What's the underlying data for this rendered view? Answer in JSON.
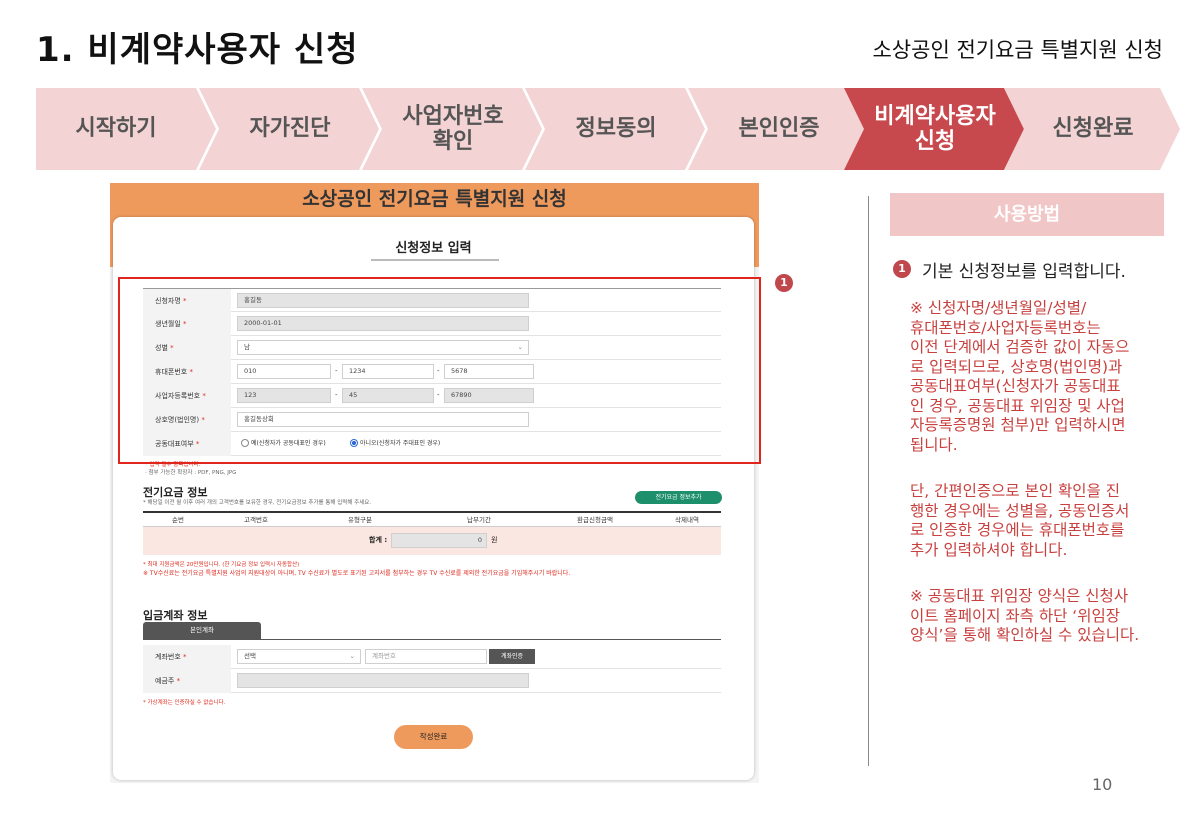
{
  "header": {
    "title": "1. 비계약사용자 신청",
    "subtitle": "소상공인 전기요금 특별지원 신청"
  },
  "steps": [
    {
      "label": "시작하기",
      "active": false
    },
    {
      "label": "자가진단",
      "active": false
    },
    {
      "label": "사업자번호\n확인",
      "active": false
    },
    {
      "label": "정보동의",
      "active": false
    },
    {
      "label": "본인인증",
      "active": false
    },
    {
      "label": "비계약사용자\n신청",
      "active": true
    },
    {
      "label": "신청완료",
      "active": false
    }
  ],
  "colors": {
    "step_inactive": "#f3d3d4",
    "step_active": "#c8494d",
    "accent_orange": "#ef9a5d",
    "highlight_red": "#e0261c",
    "note_red": "#c8413f"
  },
  "form": {
    "page_title": "소상공인 전기요금 특별지원 신청",
    "card_title": "신청정보 입력",
    "fields": {
      "applicant_name": {
        "label": "신청자명",
        "value": "홍길동"
      },
      "birth_date": {
        "label": "생년월일",
        "value": "2000-01-01"
      },
      "gender": {
        "label": "성별",
        "value": "남"
      },
      "mobile": {
        "label": "휴대폰번호",
        "part1": "010",
        "part2": "1234",
        "part3": "5678"
      },
      "biz_no": {
        "label": "사업자등록번호",
        "part1": "123",
        "part2": "45",
        "part3": "67890"
      },
      "company_name": {
        "label": "상호명(법인명)",
        "value": "홍길동상회"
      },
      "co_rep": {
        "label": "공동대표여부",
        "opt_yes": "예(신청자가 공동대표인 경우)",
        "opt_no": "아니오(신청자가 주대표인 경우)"
      }
    },
    "note_required": "* 입력 필수 항목입니다.",
    "note_attach": "· 첨부 가능한 확장자 : PDF, PNG, JPG",
    "electric": {
      "title": "전기요금 정보",
      "desc": "* 해당일 이전 월 이후 여러 개의 고객번호를 보유한 경우, 전기요금정보 추가를 통해 입력해 주세요.",
      "add_button": "전기요금 정보추가",
      "columns": [
        "순번",
        "고객번호",
        "유형구분",
        "납부기간",
        "환급신청금액",
        "삭제내역"
      ],
      "sum_label": "합계 :",
      "sum_value": "0",
      "sum_unit": "원",
      "note1": "* 최대 지원금액은 20만원입니다. (한 기요금 정보 입력시 자동합산)",
      "note2": "※ TV수신료는 전기요금 특별지원 사업의 지원대상이 아니며, TV 수신료가 별도로 표기된 고지서를 첨부하는 경우 TV 수신료를 제외한 전기요금을 기입해주시기 바랍니다."
    },
    "deposit": {
      "title": "입금계좌 정보",
      "tab": "본인계좌",
      "account_label": "계좌번호",
      "bank_select": "선택",
      "account_placeholder": "계좌번호",
      "verify_button": "계좌인증",
      "holder_label": "예금주",
      "note": "* 가상계좌는 인증하실 수 없습니다."
    },
    "submit_button": "작성완료"
  },
  "callout_number": "1",
  "usage": {
    "title": "사용방법",
    "step_number": "1",
    "main": "기본 신청정보를 입력합니다.",
    "note1": "※ 신청자명/생년월일/성별/\n휴대폰번호/사업자등록번호는\n이전 단계에서 검증한 값이 자동으\n로 입력되므로, 상호명(법인명)과\n공동대표여부(신청자가 공동대표\n인 경우, 공동대표 위임장 및 사업\n자등록증명원 첨부)만 입력하시면\n됩니다.",
    "note2": "단, 간편인증으로 본인 확인을 진\n행한 경우에는 성별을, 공동인증서\n로 인증한 경우에는 휴대폰번호를\n추가 입력하셔야 합니다.",
    "note3": "※ 공동대표 위임장 양식은 신청사\n이트 홈페이지 좌측 하단 ‘위임장\n양식’을 통해 확인하실 수 있습니다."
  },
  "page_number": "10"
}
